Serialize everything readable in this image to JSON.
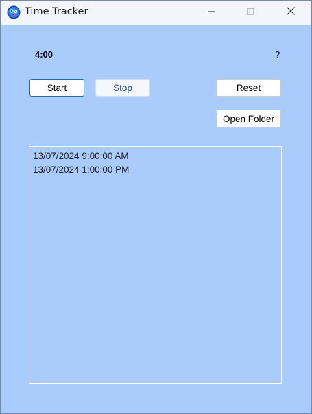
{
  "window": {
    "title": "Time Tracker",
    "icon": "gear-cluster-icon",
    "controls": [
      "minimize-icon",
      "maximize-icon",
      "close-icon"
    ]
  },
  "timer": {
    "value": "4:00"
  },
  "help": {
    "label": "?"
  },
  "buttons": {
    "start": "Start",
    "stop": "Stop",
    "reset": "Reset",
    "open_folder": "Open Folder"
  },
  "log": {
    "entries": [
      "13/07/2024 9:00:00 AM",
      "13/07/2024 1:00:00 PM"
    ]
  },
  "colors": {
    "background": "#a9ccfd",
    "titlebar": "#f2f5fa",
    "accent_border": "#1d6aa8"
  }
}
